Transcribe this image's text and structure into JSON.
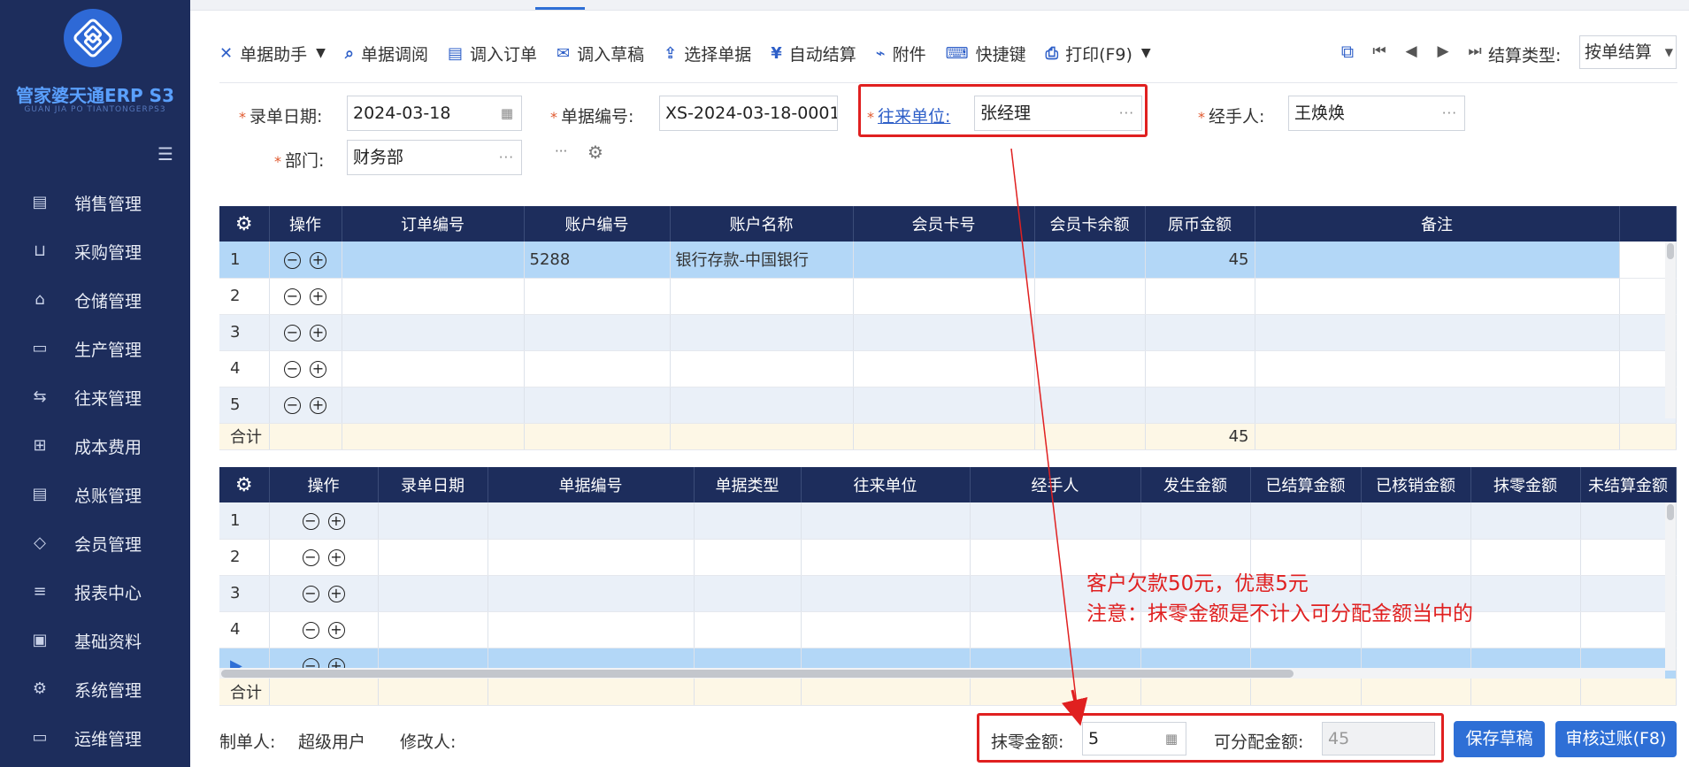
{
  "brand": {
    "name": "管家婆天通ERP S3",
    "sub": "GUAN JIA PO TIANTONGERPS3"
  },
  "sidebar": {
    "items": [
      {
        "label": "销售管理",
        "icon": "sales-icon"
      },
      {
        "label": "采购管理",
        "icon": "cart-icon"
      },
      {
        "label": "仓储管理",
        "icon": "warehouse-icon"
      },
      {
        "label": "生产管理",
        "icon": "factory-icon"
      },
      {
        "label": "往来管理",
        "icon": "exchange-icon"
      },
      {
        "label": "成本费用",
        "icon": "cost-icon"
      },
      {
        "label": "总账管理",
        "icon": "ledger-icon"
      },
      {
        "label": "会员管理",
        "icon": "diamond-icon"
      },
      {
        "label": "报表中心",
        "icon": "report-icon"
      },
      {
        "label": "基础资料",
        "icon": "card-icon"
      },
      {
        "label": "系统管理",
        "icon": "gear-icon"
      },
      {
        "label": "运维管理",
        "icon": "monitor-icon"
      }
    ]
  },
  "toolbar": {
    "assistant": "单据助手",
    "review": "单据调阅",
    "import_order": "调入订单",
    "import_draft": "调入草稿",
    "select_doc": "选择单据",
    "auto_settle": "自动结算",
    "attachment": "附件",
    "shortcut": "快捷键",
    "print": "打印(F9)",
    "settle_type_label": "结算类型:",
    "settle_type_value": "按单结算"
  },
  "form": {
    "date_label": "录单日期:",
    "date_value": "2024-03-18",
    "doc_no_label": "单据编号:",
    "doc_no_value": "XS-2024-03-18-0001",
    "partner_label": "往来单位:",
    "partner_value": "张经理",
    "handler_label": "经手人:",
    "handler_value": "王焕焕",
    "dept_label": "部门:",
    "dept_value": "财务部",
    "ellipsis": "···"
  },
  "accounts_table": {
    "headers": [
      "操作",
      "订单编号",
      "账户编号",
      "账户名称",
      "会员卡号",
      "会员卡余额",
      "原币金额",
      "备注"
    ],
    "rows": [
      {
        "idx": "1",
        "order_no": "",
        "acct_no": "5288",
        "acct_name": "银行存款-中国银行",
        "card_no": "",
        "card_bal": "",
        "amount": "45",
        "remark": ""
      },
      {
        "idx": "2",
        "order_no": "",
        "acct_no": "",
        "acct_name": "",
        "card_no": "",
        "card_bal": "",
        "amount": "",
        "remark": ""
      },
      {
        "idx": "3",
        "order_no": "",
        "acct_no": "",
        "acct_name": "",
        "card_no": "",
        "card_bal": "",
        "amount": "",
        "remark": ""
      },
      {
        "idx": "4",
        "order_no": "",
        "acct_no": "",
        "acct_name": "",
        "card_no": "",
        "card_bal": "",
        "amount": "",
        "remark": ""
      },
      {
        "idx": "5",
        "order_no": "",
        "acct_no": "",
        "acct_name": "",
        "card_no": "",
        "card_bal": "",
        "amount": "",
        "remark": ""
      }
    ],
    "total_label": "合计",
    "total_amount": "45"
  },
  "docs_table": {
    "headers": [
      "操作",
      "录单日期",
      "单据编号",
      "单据类型",
      "往来单位",
      "经手人",
      "发生金额",
      "已结算金额",
      "已核销金额",
      "抹零金额",
      "未结算金额"
    ],
    "rows": [
      {
        "idx": "1"
      },
      {
        "idx": "2"
      },
      {
        "idx": "3"
      },
      {
        "idx": "4"
      },
      {
        "idx": "▶"
      }
    ],
    "total_label": "合计"
  },
  "annotation": {
    "line1": "客户欠款50元，优惠5元",
    "line2": "注意：抹零金额是不计入可分配金额当中的"
  },
  "footer": {
    "creator_label": "制单人:",
    "creator_value": "超级用户",
    "modifier_label": "修改人:",
    "rounding_label": "抹零金额:",
    "rounding_value": "5",
    "allocatable_label": "可分配金额:",
    "allocatable_value": "45",
    "save_draft": "保存草稿",
    "approve": "审核过账(F8)"
  },
  "colors": {
    "sidebar": "#1d2d5c",
    "accent": "#2e6fd6",
    "annotation": "#e02020",
    "selected_row": "#b3d7f7"
  }
}
